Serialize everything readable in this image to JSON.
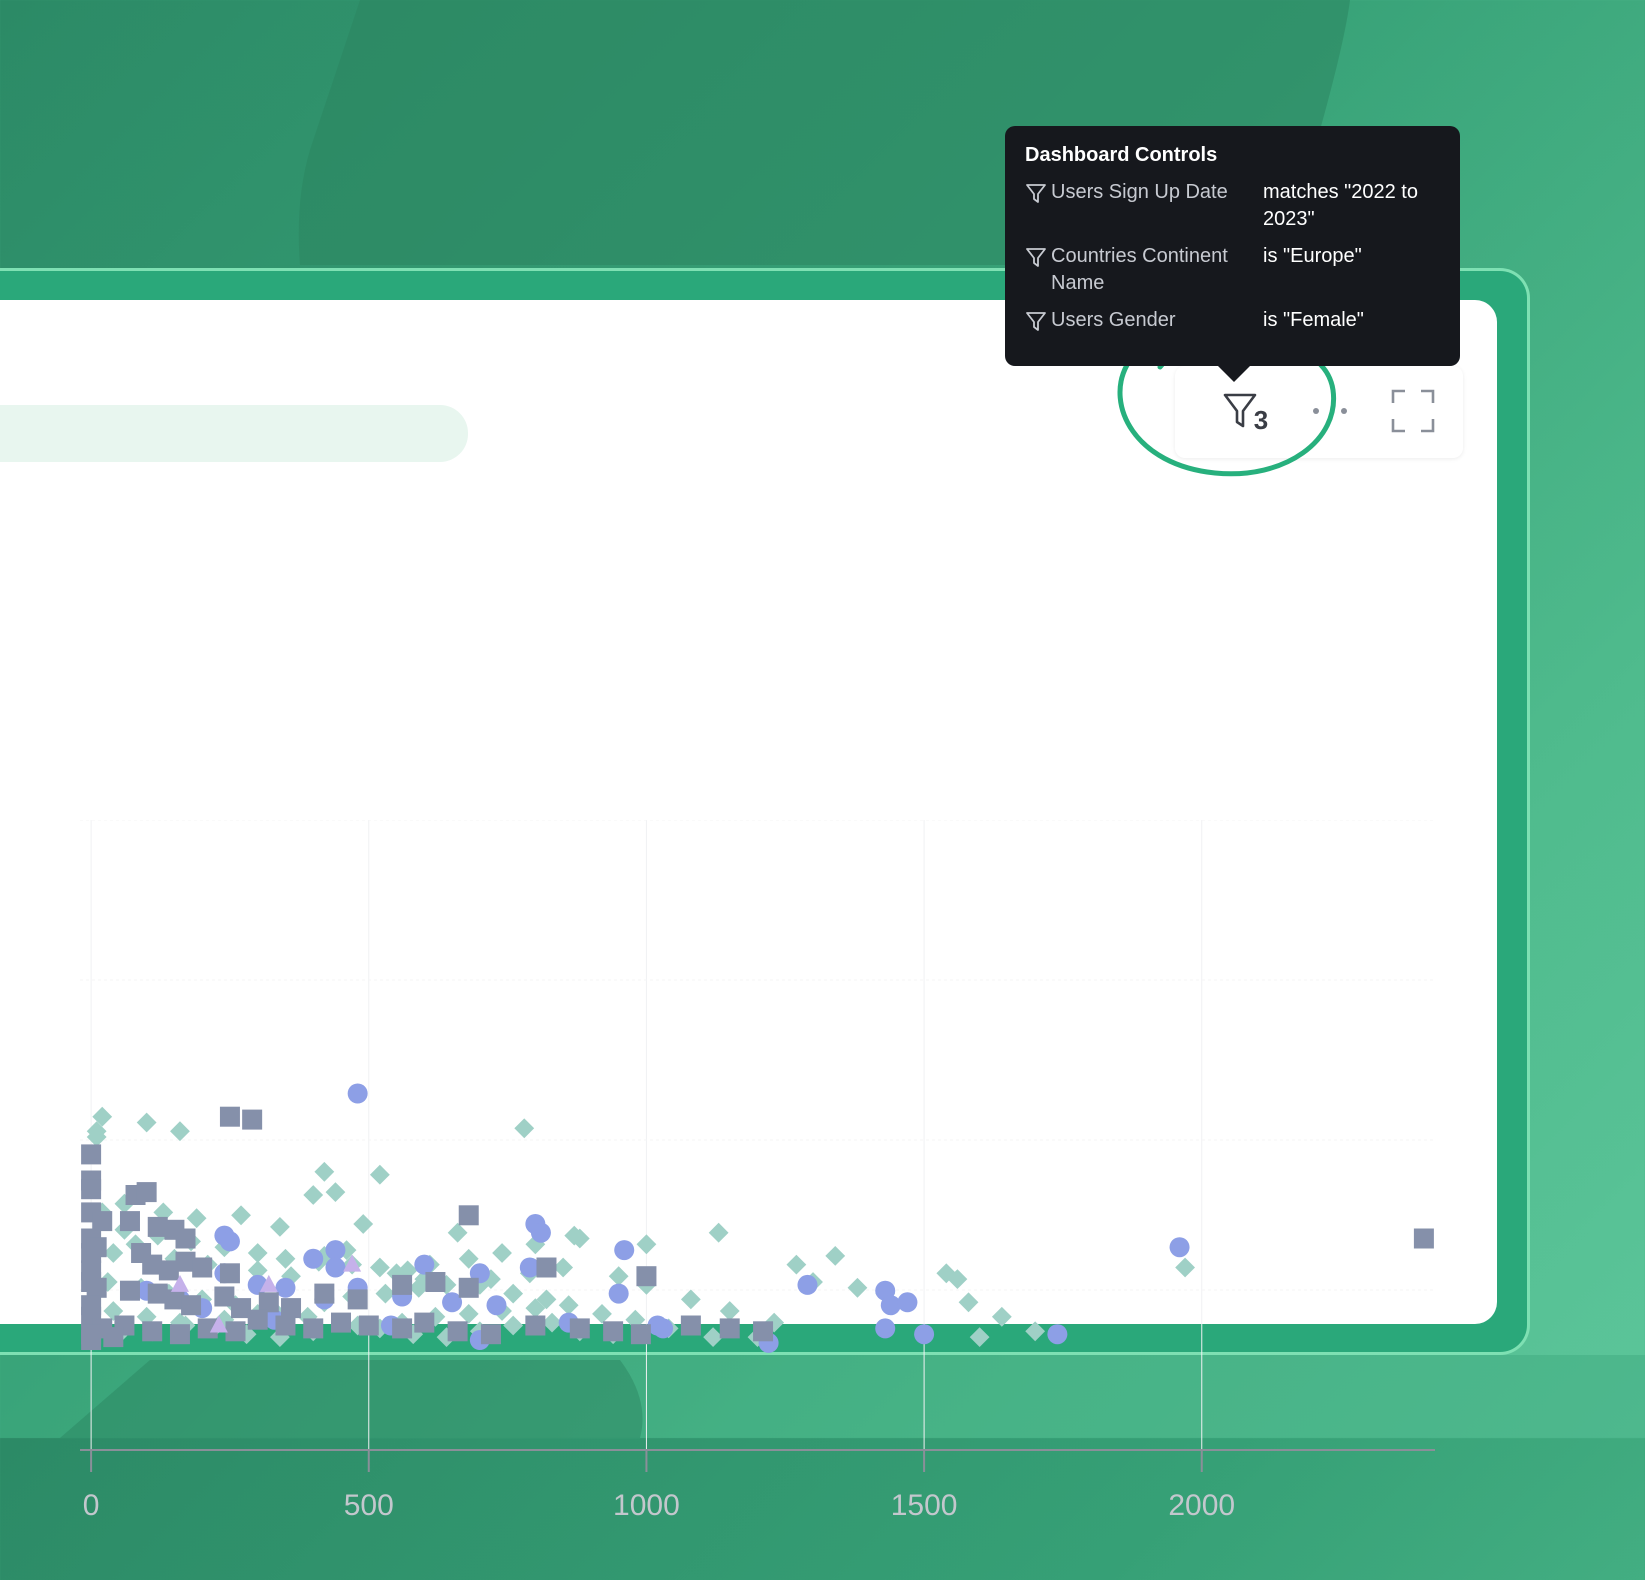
{
  "colors": {
    "background": "#36a076",
    "frame_border": "#7ee0b3",
    "ring": "#27b07d",
    "tooltip_bg": "#16181d",
    "series_diamond": "#9fd0c6",
    "series_circle": "#8d9fe6",
    "series_square": "#8590aa",
    "series_triangle": "#c5b1ea"
  },
  "dashboard_controls": {
    "title": "Dashboard Controls",
    "filters": [
      {
        "field": "Users Sign Up Date",
        "value": "matches \"2022 to 2023\""
      },
      {
        "field": "Countries Continent Name",
        "value": "is \"Europe\""
      },
      {
        "field": "Users Gender",
        "value": "is \"Female\""
      }
    ]
  },
  "toolbar": {
    "filter_icon": "funnel-icon",
    "filter_count": "3",
    "more_icon": "more-horizontal-icon",
    "fullscreen_icon": "expand-icon"
  },
  "chart_data": {
    "type": "scatter",
    "xlim": [
      -20,
      2420
    ],
    "ylim": [
      0,
      100
    ],
    "x_ticks": [
      0,
      500,
      1000,
      1500,
      2000
    ],
    "x_tick_labels": [
      "0",
      "500",
      "1000",
      "1500",
      "2000"
    ],
    "grid": true,
    "series": [
      {
        "marker": "diamond",
        "points": [
          [
            10,
            70
          ],
          [
            20,
            77
          ],
          [
            100,
            75
          ],
          [
            160,
            72
          ],
          [
            780,
            73
          ],
          [
            10,
            72
          ],
          [
            420,
            58
          ],
          [
            520,
            57
          ],
          [
            400,
            50
          ],
          [
            440,
            51
          ],
          [
            20,
            44
          ],
          [
            60,
            47
          ],
          [
            130,
            44
          ],
          [
            190,
            42
          ],
          [
            270,
            43
          ],
          [
            340,
            39
          ],
          [
            490,
            40
          ],
          [
            660,
            37
          ],
          [
            880,
            35
          ],
          [
            1000,
            33
          ],
          [
            1130,
            37
          ],
          [
            1340,
            29
          ],
          [
            1970,
            25
          ],
          [
            40,
            30
          ],
          [
            80,
            33
          ],
          [
            150,
            28
          ],
          [
            210,
            26
          ],
          [
            300,
            24
          ],
          [
            360,
            22
          ],
          [
            420,
            29
          ],
          [
            460,
            31
          ],
          [
            550,
            23
          ],
          [
            600,
            21
          ],
          [
            700,
            19
          ],
          [
            760,
            16
          ],
          [
            820,
            14
          ],
          [
            950,
            22
          ],
          [
            1000,
            19
          ],
          [
            1080,
            14
          ],
          [
            1150,
            10
          ],
          [
            1230,
            6
          ],
          [
            1270,
            26
          ],
          [
            1300,
            20
          ],
          [
            1380,
            18
          ],
          [
            1430,
            16
          ],
          [
            1540,
            23
          ],
          [
            1560,
            21
          ],
          [
            1580,
            13
          ],
          [
            1640,
            8
          ],
          [
            1700,
            3
          ],
          [
            1600,
            1
          ],
          [
            1200,
            1
          ],
          [
            1120,
            1
          ],
          [
            30,
            20
          ],
          [
            90,
            18
          ],
          [
            140,
            16
          ],
          [
            200,
            14
          ],
          [
            260,
            12
          ],
          [
            330,
            10
          ],
          [
            390,
            8
          ],
          [
            450,
            6
          ],
          [
            520,
            4
          ],
          [
            580,
            2
          ],
          [
            640,
            1
          ],
          [
            700,
            3
          ],
          [
            760,
            5
          ],
          [
            830,
            6
          ],
          [
            880,
            3
          ],
          [
            940,
            2
          ],
          [
            1040,
            4
          ],
          [
            40,
            10
          ],
          [
            100,
            8
          ],
          [
            160,
            6
          ],
          [
            220,
            4
          ],
          [
            280,
            2
          ],
          [
            340,
            1
          ],
          [
            400,
            3
          ],
          [
            480,
            5
          ],
          [
            560,
            6
          ],
          [
            620,
            8
          ],
          [
            680,
            9
          ],
          [
            740,
            10
          ],
          [
            800,
            11
          ],
          [
            860,
            12
          ],
          [
            920,
            9
          ],
          [
            980,
            7
          ],
          [
            50,
            2
          ],
          [
            110,
            3
          ],
          [
            170,
            5
          ],
          [
            240,
            7
          ],
          [
            300,
            9
          ],
          [
            360,
            11
          ],
          [
            420,
            13
          ],
          [
            470,
            15
          ],
          [
            530,
            16
          ],
          [
            590,
            18
          ],
          [
            640,
            19
          ],
          [
            720,
            21
          ],
          [
            790,
            23
          ],
          [
            850,
            25
          ],
          [
            60,
            38
          ],
          [
            120,
            36
          ],
          [
            180,
            34
          ],
          [
            240,
            32
          ],
          [
            300,
            30
          ],
          [
            350,
            28
          ],
          [
            410,
            27
          ],
          [
            470,
            26
          ],
          [
            520,
            25
          ],
          [
            570,
            24
          ],
          [
            610,
            26
          ],
          [
            680,
            28
          ],
          [
            740,
            30
          ],
          [
            800,
            33
          ],
          [
            870,
            36
          ]
        ]
      },
      {
        "marker": "circle",
        "points": [
          [
            480,
            85
          ],
          [
            800,
            40
          ],
          [
            810,
            37
          ],
          [
            240,
            36
          ],
          [
            250,
            34
          ],
          [
            440,
            31
          ],
          [
            400,
            28
          ],
          [
            960,
            31
          ],
          [
            440,
            25
          ],
          [
            600,
            26
          ],
          [
            700,
            23
          ],
          [
            790,
            25
          ],
          [
            240,
            23
          ],
          [
            300,
            19
          ],
          [
            350,
            18
          ],
          [
            420,
            14
          ],
          [
            480,
            18
          ],
          [
            560,
            15
          ],
          [
            650,
            13
          ],
          [
            730,
            12
          ],
          [
            950,
            16
          ],
          [
            1290,
            19
          ],
          [
            1430,
            17
          ],
          [
            1440,
            12
          ],
          [
            1470,
            13
          ],
          [
            1960,
            32
          ],
          [
            1740,
            2
          ],
          [
            1500,
            2
          ],
          [
            1430,
            4
          ],
          [
            1220,
            -1
          ],
          [
            1030,
            4
          ],
          [
            1020,
            5
          ],
          [
            860,
            6
          ],
          [
            700,
            0
          ],
          [
            540,
            5
          ],
          [
            330,
            7
          ],
          [
            200,
            11
          ],
          [
            160,
            14
          ],
          [
            100,
            17
          ]
        ]
      },
      {
        "marker": "square",
        "points": [
          [
            250,
            77
          ],
          [
            290,
            76
          ],
          [
            0,
            64
          ],
          [
            0,
            55
          ],
          [
            0,
            52
          ],
          [
            80,
            50
          ],
          [
            100,
            51
          ],
          [
            0,
            44
          ],
          [
            20,
            41
          ],
          [
            70,
            41
          ],
          [
            120,
            39
          ],
          [
            150,
            38
          ],
          [
            170,
            35
          ],
          [
            0,
            35
          ],
          [
            0,
            30
          ],
          [
            10,
            32
          ],
          [
            90,
            30
          ],
          [
            110,
            26
          ],
          [
            140,
            24
          ],
          [
            170,
            27
          ],
          [
            200,
            25
          ],
          [
            250,
            23
          ],
          [
            0,
            24
          ],
          [
            0,
            20
          ],
          [
            10,
            18
          ],
          [
            70,
            17
          ],
          [
            120,
            16
          ],
          [
            150,
            14
          ],
          [
            180,
            12
          ],
          [
            240,
            15
          ],
          [
            270,
            11
          ],
          [
            320,
            13
          ],
          [
            360,
            11
          ],
          [
            420,
            16
          ],
          [
            480,
            14
          ],
          [
            560,
            19
          ],
          [
            620,
            20
          ],
          [
            680,
            18
          ],
          [
            0,
            12
          ],
          [
            0,
            8
          ],
          [
            20,
            4
          ],
          [
            60,
            5
          ],
          [
            110,
            3
          ],
          [
            160,
            2
          ],
          [
            210,
            4
          ],
          [
            260,
            3
          ],
          [
            300,
            7
          ],
          [
            350,
            5
          ],
          [
            400,
            4
          ],
          [
            450,
            6
          ],
          [
            500,
            5
          ],
          [
            560,
            4
          ],
          [
            600,
            6
          ],
          [
            660,
            3
          ],
          [
            720,
            2
          ],
          [
            800,
            5
          ],
          [
            880,
            4
          ],
          [
            940,
            3
          ],
          [
            990,
            2
          ],
          [
            1080,
            5
          ],
          [
            1150,
            4
          ],
          [
            1210,
            3
          ],
          [
            680,
            43
          ],
          [
            820,
            25
          ],
          [
            1000,
            22
          ],
          [
            2400,
            35
          ],
          [
            0,
            2
          ],
          [
            0,
            0
          ],
          [
            40,
            1
          ]
        ]
      },
      {
        "marker": "triangle",
        "points": [
          [
            470,
            26
          ],
          [
            160,
            19
          ],
          [
            320,
            19
          ],
          [
            230,
            5
          ]
        ]
      }
    ]
  }
}
